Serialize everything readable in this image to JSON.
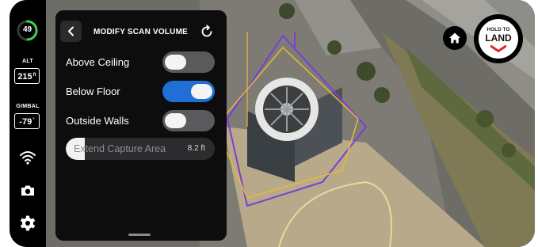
{
  "status_rail": {
    "battery_value": "49",
    "battery_percent": 49,
    "altitude_label": "ALT",
    "altitude_value": "215",
    "altitude_unit": "ft",
    "gimbal_label": "GIMBAL",
    "gimbal_value": "-79",
    "gimbal_unit": "°",
    "icons": [
      "wifi-signal-icon",
      "camera-icon",
      "settings-gear-icon"
    ]
  },
  "scan_panel": {
    "title": "MODIFY SCAN VOLUME",
    "options": [
      {
        "label": "Above Ceiling",
        "enabled": false
      },
      {
        "label": "Below Floor",
        "enabled": true
      },
      {
        "label": "Outside Walls",
        "enabled": false
      }
    ],
    "extend_capture": {
      "label": "Extend Capture Area",
      "value": "8.2 ft",
      "fraction": 0.13
    }
  },
  "controls": {
    "land_top_label": "HOLD TO",
    "land_label": "LAND"
  },
  "colors": {
    "accent_blue": "#1f6fd6",
    "battery_green": "#3fd14a",
    "land_red": "#e0262b",
    "scan_outline_purple": "#7a3fd6",
    "scan_outline_yellow": "#e8b93a"
  }
}
